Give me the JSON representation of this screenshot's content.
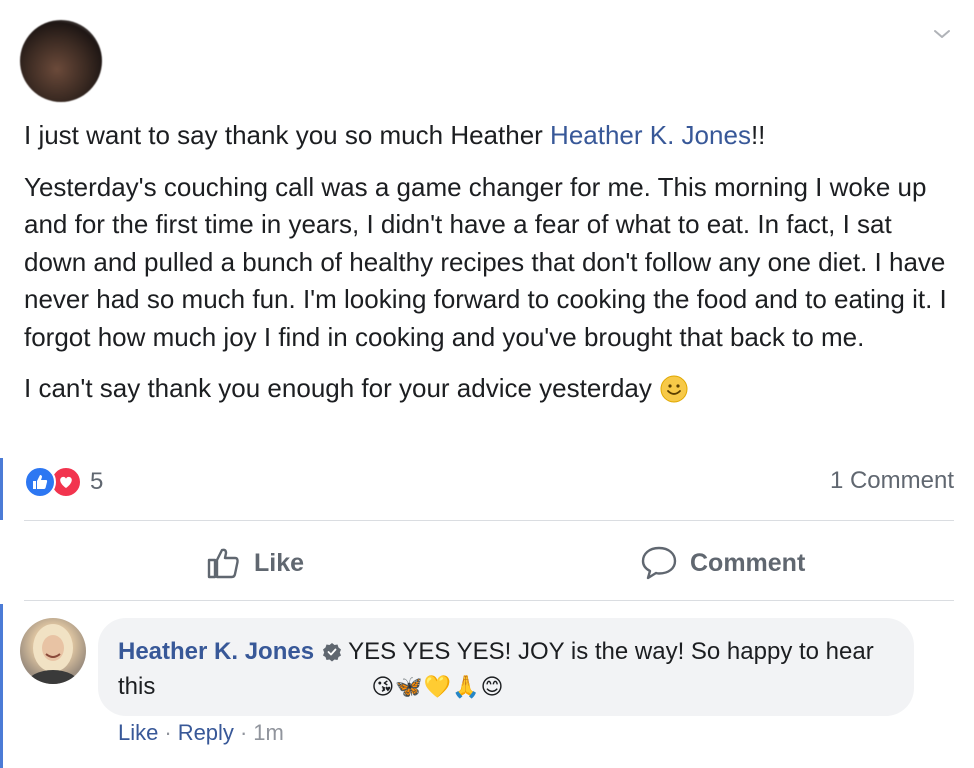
{
  "post": {
    "paragraph1_pre": "I just want to say thank you so much Heather ",
    "mention": "Heather K. Jones",
    "paragraph1_post": "!!",
    "paragraph2": "Yesterday's couching call was a game changer for me. This morning I woke up and for the first time in years, I didn't have a fear of what to eat. In fact, I sat down and pulled a bunch of healthy recipes that don't follow any one diet. I have never had so much fun. I'm looking forward to cooking the food and to eating it. I forgot how much joy I find in cooking and you've brought that back to me.",
    "paragraph3": "I can't say thank you enough for your advice yesterday"
  },
  "reactions": {
    "icons": [
      "like-icon",
      "love-icon"
    ],
    "count": "5",
    "comment_count": "1 Comment"
  },
  "actions": {
    "like_label": "Like",
    "comment_label": "Comment"
  },
  "comment": {
    "author": "Heather K. Jones",
    "text": "YES YES YES! JOY is the way! So happy to hear this",
    "emojis": "😘🦋💛🙏😊",
    "like_label": "Like",
    "reply_label": "Reply",
    "time": "1m"
  },
  "colors": {
    "link": "#385898",
    "like_blue": "#2d77f2",
    "love_red": "#f2344e",
    "accent_bar": "#4b7bd6"
  }
}
